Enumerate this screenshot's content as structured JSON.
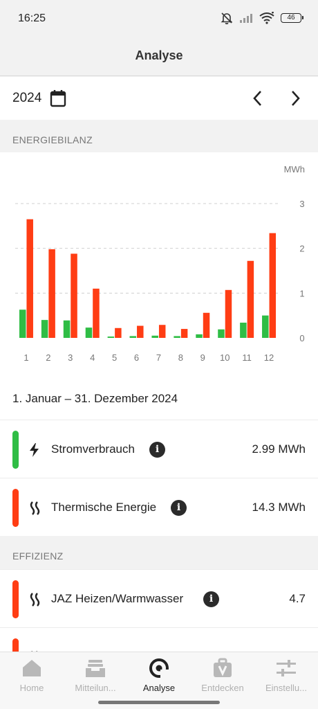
{
  "status": {
    "time": "16:25",
    "battery": "46"
  },
  "appbar": {
    "title": "Analyse"
  },
  "year": {
    "value": "2024"
  },
  "sections": {
    "energy": "ENERGIEBILANZ",
    "efficiency": "EFFIZIENZ"
  },
  "chart_data": {
    "type": "bar",
    "ylabel": "MWh",
    "ylim": [
      0,
      3
    ],
    "yticks": [
      "0",
      "1",
      "2",
      "3"
    ],
    "categories": [
      "1",
      "2",
      "3",
      "4",
      "5",
      "6",
      "7",
      "8",
      "9",
      "10",
      "11",
      "12"
    ],
    "series": [
      {
        "color": "#2fbd45",
        "values": [
          0.63,
          0.4,
          0.39,
          0.23,
          0.03,
          0.04,
          0.05,
          0.04,
          0.08,
          0.19,
          0.34,
          0.5
        ]
      },
      {
        "color": "#ff3d14",
        "values": [
          2.65,
          1.98,
          1.88,
          1.1,
          0.22,
          0.27,
          0.29,
          0.2,
          0.56,
          1.07,
          1.72,
          2.34
        ]
      }
    ],
    "gridlines": "dashed"
  },
  "period": "1. Januar – 31. Dezember 2024",
  "rows": [
    {
      "label": "Stromverbrauch",
      "value": "2.99 MWh",
      "color": "#2fbd45",
      "icon": "lightning-icon"
    },
    {
      "label": "Thermische Energie",
      "value": "14.3 MWh",
      "color": "#ff3d14",
      "icon": "heat-waves-icon"
    }
  ],
  "efficiency_rows": [
    {
      "label": "JAZ Heizen/Warmwasser",
      "value": "4.7",
      "color": "#ff3d14",
      "icon": "heat-waves-icon"
    }
  ],
  "nav": [
    {
      "label": "Home",
      "icon": "home-icon"
    },
    {
      "label": "Mitteilun...",
      "icon": "inbox-icon"
    },
    {
      "label": "Analyse",
      "icon": "analyse-icon"
    },
    {
      "label": "Entdecken",
      "icon": "discover-bag-icon"
    },
    {
      "label": "Einstellu...",
      "icon": "sliders-icon"
    }
  ],
  "info_glyph": "i"
}
